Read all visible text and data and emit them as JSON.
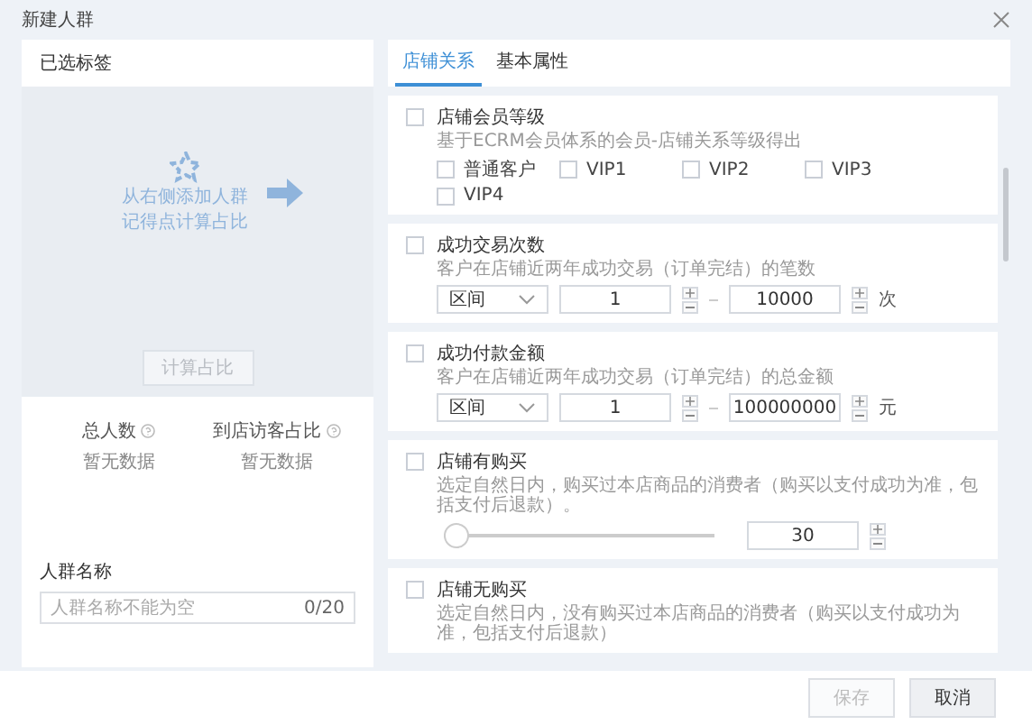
{
  "window": {
    "title": "新建人群"
  },
  "left": {
    "header": "已选标签",
    "hint_lines": [
      "从右侧添加人群",
      "记得点计算占比"
    ],
    "calc_button": {
      "label": "计算占比",
      "disabled": true
    },
    "stats": [
      {
        "label": "总人数",
        "value": "暂无数据"
      },
      {
        "label": "到店访客占比",
        "value": "暂无数据"
      }
    ],
    "name_field": {
      "label": "人群名称",
      "placeholder": "人群名称不能为空",
      "counter": "0/20"
    }
  },
  "tabs": [
    {
      "label": "店铺关系",
      "selected": true
    },
    {
      "label": "基本属性",
      "selected": false
    }
  ],
  "cards": [
    {
      "kind": "levels",
      "title": "店铺会员等级",
      "checked": false,
      "description": "基于ECRM会员体系的会员-店铺关系等级得出",
      "options": [
        {
          "label": "普通客户",
          "checked": false
        },
        {
          "label": "VIP1",
          "checked": false
        },
        {
          "label": "VIP2",
          "checked": false
        },
        {
          "label": "VIP3",
          "checked": false
        },
        {
          "label": "VIP4",
          "checked": false
        }
      ]
    },
    {
      "kind": "range",
      "title": "成功交易次数",
      "checked": false,
      "description": "客户在店铺近两年成功交易（订单完结）的笔数",
      "mode": "区间",
      "min": "1",
      "max": "10000",
      "unit": "次"
    },
    {
      "kind": "range",
      "title": "成功付款金额",
      "checked": false,
      "description": "客户在店铺近两年成功交易（订单完结）的总金额",
      "mode": "区间",
      "min": "1",
      "max": "100000000",
      "unit": "元"
    },
    {
      "kind": "slider",
      "title": "店铺有购买",
      "checked": false,
      "description": "选定自然日内，购买过本店商品的消费者（购买以支付成功为准，包括支付后退款）。",
      "level": 0,
      "value": "30"
    },
    {
      "kind": "plain",
      "title": "店铺无购买",
      "checked": false,
      "description": "选定自然日内，没有购买过本店商品的消费者（购买以支付成功为准，包括支付后退款）"
    }
  ],
  "footer_buttons": [
    {
      "label": "保存",
      "disabled": true
    },
    {
      "label": "取消",
      "disabled": false
    }
  ]
}
